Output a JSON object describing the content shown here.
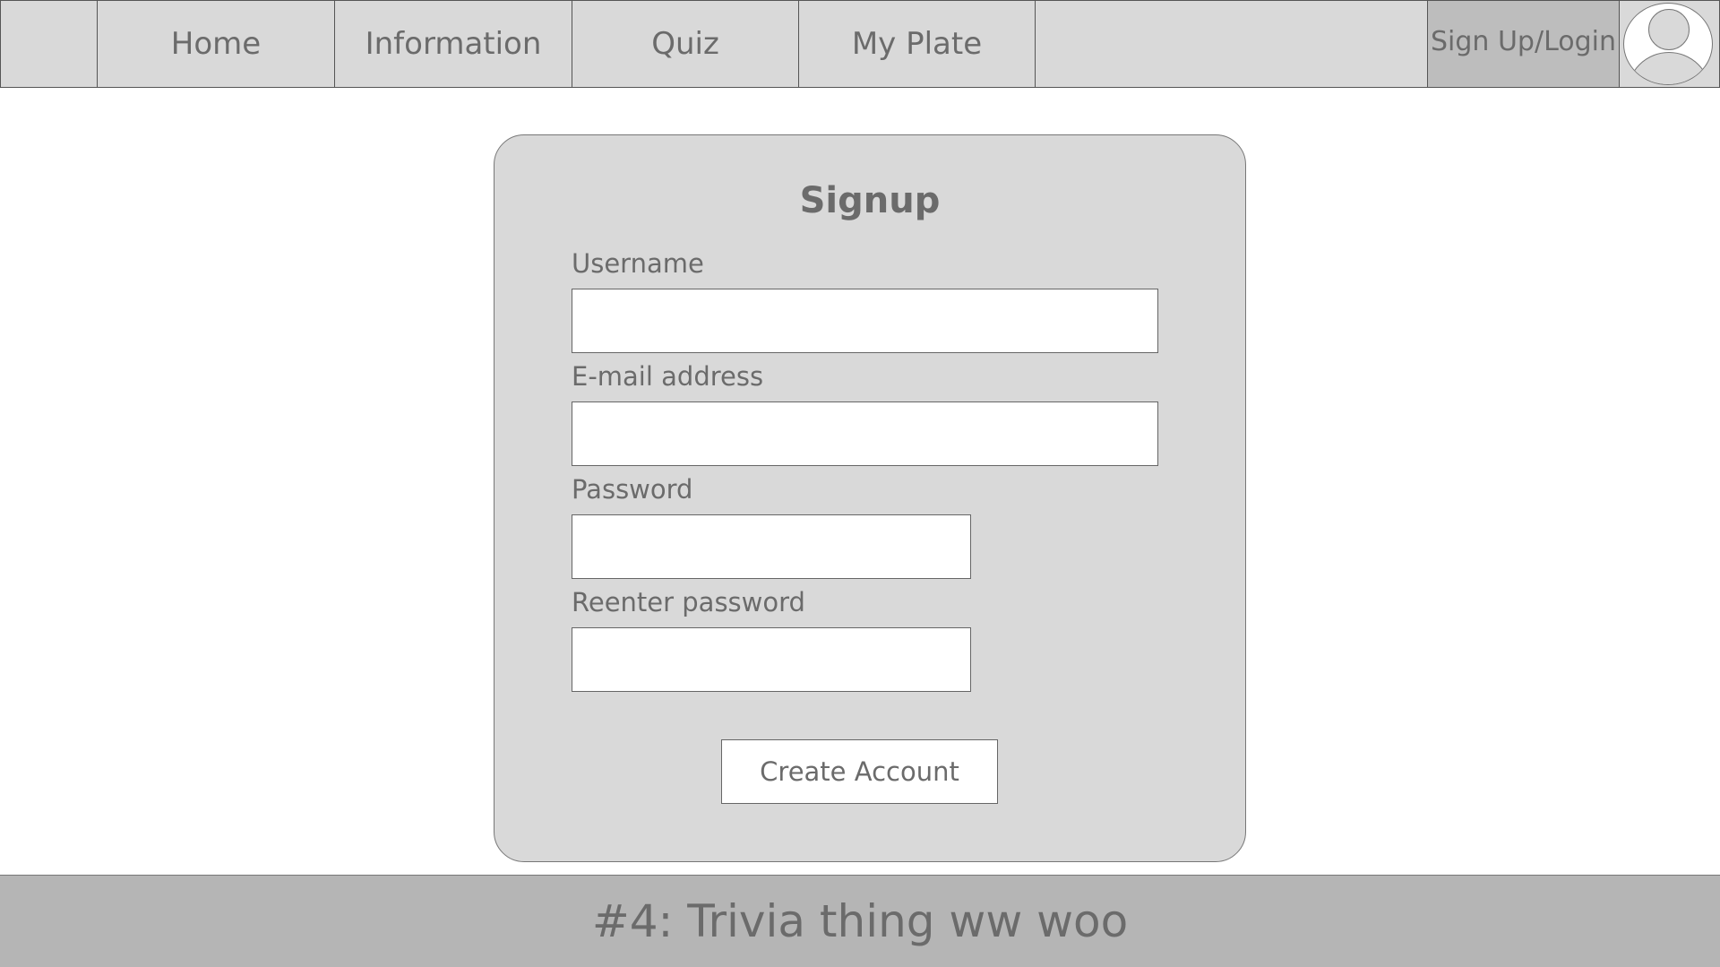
{
  "nav": {
    "items": [
      {
        "label": "Home"
      },
      {
        "label": "Information"
      },
      {
        "label": "Quiz"
      },
      {
        "label": "My Plate"
      }
    ],
    "login_label": "Sign Up/Login",
    "avatar_icon": "user-avatar-icon"
  },
  "signup": {
    "title": "Signup",
    "fields": [
      {
        "label": "Username",
        "value": "",
        "placeholder": ""
      },
      {
        "label": "E-mail address",
        "value": "",
        "placeholder": ""
      },
      {
        "label": "Password",
        "value": "",
        "placeholder": ""
      },
      {
        "label": "Reenter password",
        "value": "",
        "placeholder": ""
      }
    ],
    "submit_label": "Create Account"
  },
  "footer": {
    "text": "#4: Trivia thing ww woo"
  },
  "colors": {
    "nav_background": "#d9d9d9",
    "login_background": "#bdbdbd",
    "card_background": "#d9d9d9",
    "footer_background": "#b5b5b5",
    "text": "#6b6b6b"
  }
}
